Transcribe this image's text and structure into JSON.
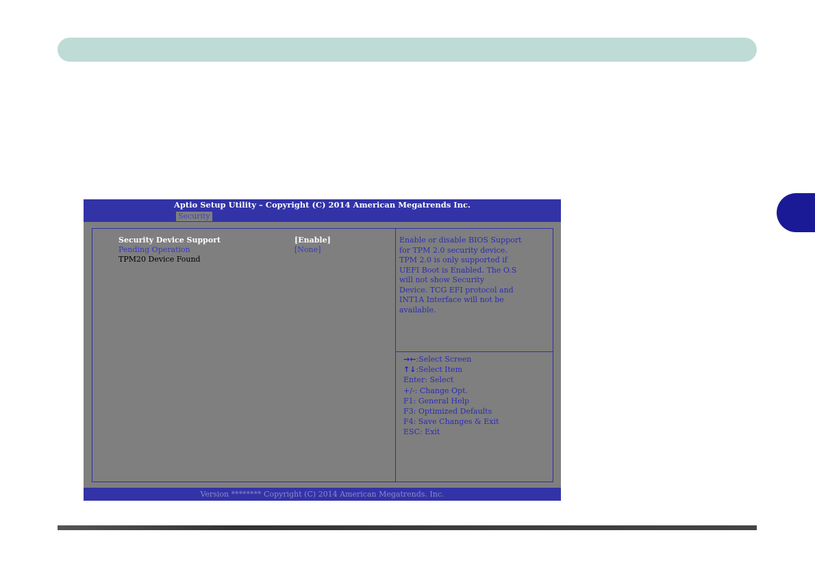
{
  "bios": {
    "title": "Aptio Setup Utility – Copyright (C) 2014 American Megatrends Inc.",
    "active_tab": "Security",
    "settings": [
      {
        "label": "Security Device Support",
        "value": "[Enable]"
      },
      {
        "label": "Pending Operation",
        "value": "[None]"
      },
      {
        "label": "TPM20 Device Found",
        "value": ""
      }
    ],
    "help_text": "Enable or disable BIOS Support\nfor TPM 2.0  security device.\nTPM 2.0 is only supported if\nUEFI Boot is Enabled. The O.S\nwill not show Security\nDevice. TCG EFI protocol and\nINT1A Interface will not be\navailable.",
    "keys": [
      {
        "arrows": "→←",
        "text": ":Select Screen"
      },
      {
        "arrows": "↑↓",
        "text": ":Select Item"
      },
      {
        "arrows": "",
        "text": "Enter: Select"
      },
      {
        "arrows": "",
        "text": "+/-: Change Opt."
      },
      {
        "arrows": "",
        "text": "F1: General Help"
      },
      {
        "arrows": "",
        "text": "F3: Optimized Defaults"
      },
      {
        "arrows": "",
        "text": "F4: Save Changes & Exit"
      },
      {
        "arrows": "",
        "text": "ESC: Exit"
      }
    ],
    "footer": "Version ******** Copyright (C) 2014 American Megatrends. Inc."
  },
  "colors": {
    "bios_blue": "#3333a8",
    "bios_gray": "#7f7f7f",
    "banner": "#bfdbd6",
    "chapter_tab": "#1a1a96"
  }
}
